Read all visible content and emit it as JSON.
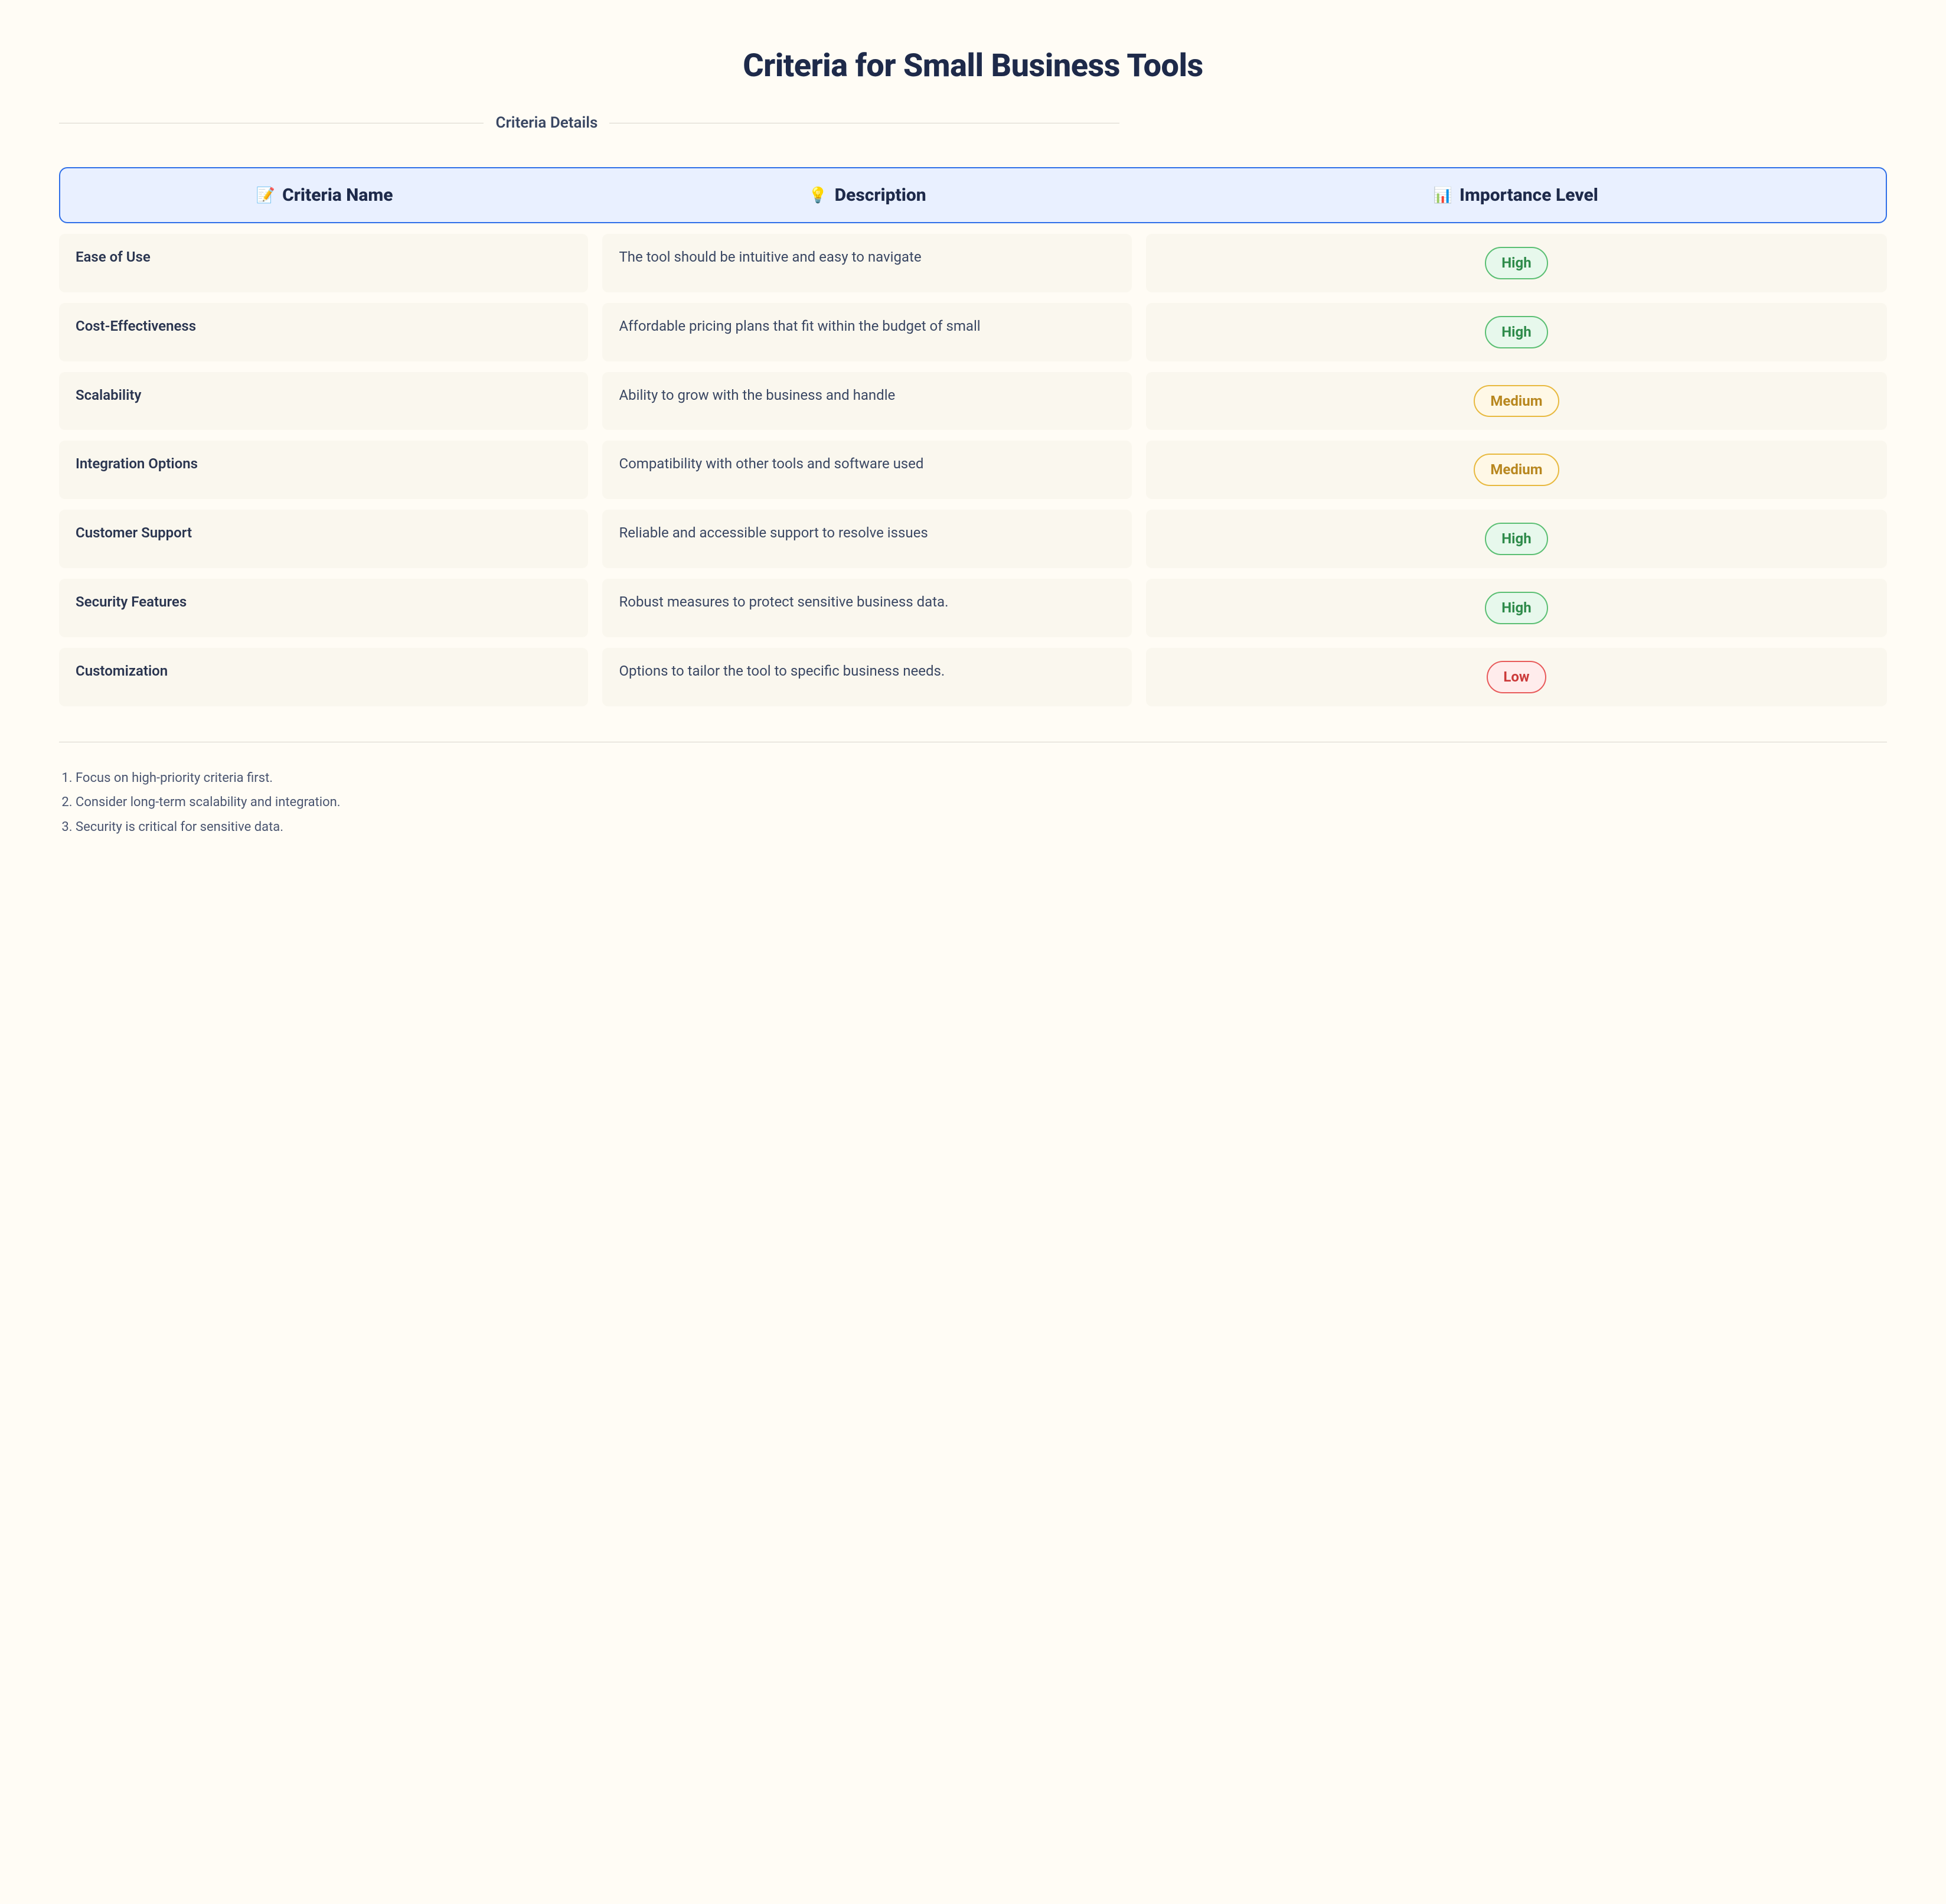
{
  "title": "Criteria for Small Business Tools",
  "section_label": "Criteria Details",
  "headers": {
    "name": {
      "icon": "📝",
      "label": "Criteria Name"
    },
    "desc": {
      "icon": "💡",
      "label": "Description"
    },
    "level": {
      "icon": "📊",
      "label": "Importance Level"
    }
  },
  "rows": [
    {
      "name": "Ease of Use",
      "desc": "The tool should be intuitive and easy to navigate",
      "level": "High"
    },
    {
      "name": "Cost-Effectiveness",
      "desc": "Affordable pricing plans that fit within the budget of small",
      "level": "High"
    },
    {
      "name": "Scalability",
      "desc": "Ability to grow with the business and handle",
      "level": "Medium"
    },
    {
      "name": "Integration Options",
      "desc": "Compatibility with other tools and software used",
      "level": "Medium"
    },
    {
      "name": "Customer Support",
      "desc": "Reliable and accessible support to resolve issues",
      "level": "High"
    },
    {
      "name": "Security Features",
      "desc": "Robust measures to protect sensitive business data.",
      "level": "High"
    },
    {
      "name": "Customization",
      "desc": "Options to tailor the tool to specific business needs.",
      "level": "Low"
    }
  ],
  "notes": [
    "Focus on high-priority criteria first.",
    "Consider long-term scalability and integration.",
    "Security is critical for sensitive data."
  ]
}
